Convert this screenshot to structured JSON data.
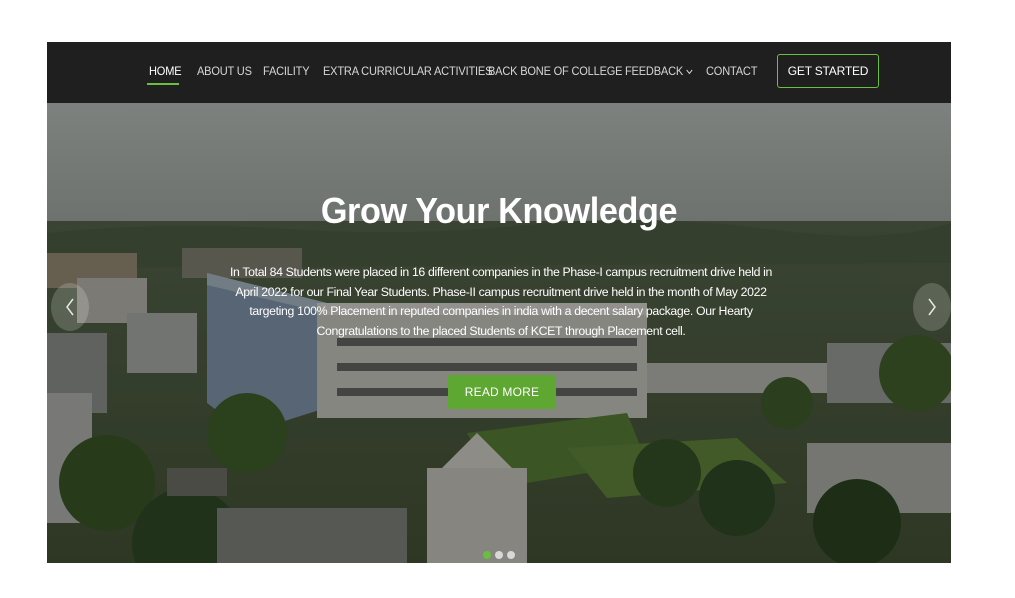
{
  "nav": {
    "items": [
      {
        "label": "HOME",
        "active": true
      },
      {
        "label": "ABOUT US"
      },
      {
        "label": "FACILITY"
      },
      {
        "label": "EXTRA CURRICULAR ACTIVITIES"
      },
      {
        "label": "BACK BONE OF COLLEGE"
      },
      {
        "label": "FEEDBACK"
      },
      {
        "label": "CONTACT"
      }
    ],
    "feedback_icon": "chevron-down-icon",
    "cta_label": "GET STARTED"
  },
  "hero": {
    "title": "Grow Your Knowledge",
    "text": "In Total 84 Students were placed in 16 different companies in the Phase-I campus recruitment drive held in April 2022 for our Final Year Students. Phase-II campus recruitment drive held in the month of May 2022 targeting 100% Placement in reputed companies in india with a decent salary package. Our Hearty Congratulations to the placed Students of KCET through Placement cell.",
    "button_label": "READ MORE",
    "prev_icon": "chevron-left-icon",
    "next_icon": "chevron-right-icon",
    "slides": 3,
    "active_slide": 1
  },
  "colors": {
    "accent": "#6abf3f",
    "nav_bg": "#1e1f1e",
    "button_bg": "#5ea732"
  }
}
